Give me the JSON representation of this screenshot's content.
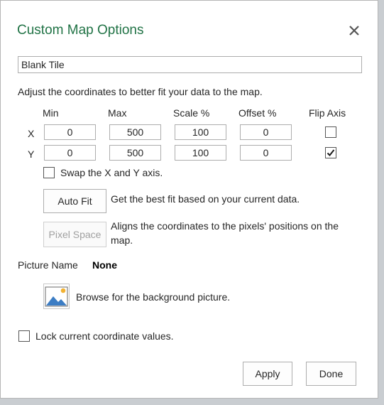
{
  "dialog": {
    "title": "Custom Map Options",
    "tile_name": "Blank Tile",
    "instructions": "Adjust the coordinates to better fit your data to the map."
  },
  "grid": {
    "headers": {
      "min": "Min",
      "max": "Max",
      "scale": "Scale %",
      "offset": "Offset %",
      "flip": "Flip Axis"
    },
    "x": {
      "label": "X",
      "min": "0",
      "max": "500",
      "scale": "100",
      "offset": "0",
      "flip": false
    },
    "y": {
      "label": "Y",
      "min": "0",
      "max": "500",
      "scale": "100",
      "offset": "0",
      "flip": true
    }
  },
  "swap": {
    "label": "Swap the X and Y axis.",
    "checked": false
  },
  "auto_fit": {
    "label": "Auto Fit",
    "description": "Get the best fit based on your current data."
  },
  "pixel_space": {
    "label": "Pixel Space",
    "description_line1": "Aligns the coordinates to the pixels' positions on the",
    "description_line2": "map.",
    "enabled": false
  },
  "picture": {
    "label": "Picture Name",
    "value": "None",
    "browse_text": "Browse for the background picture."
  },
  "lock": {
    "label": "Lock current coordinate values.",
    "checked": false
  },
  "footer": {
    "apply": "Apply",
    "done": "Done"
  },
  "colors": {
    "title": "#217346",
    "icon_blue": "#3c7dc4",
    "icon_sun": "#f2b233"
  }
}
